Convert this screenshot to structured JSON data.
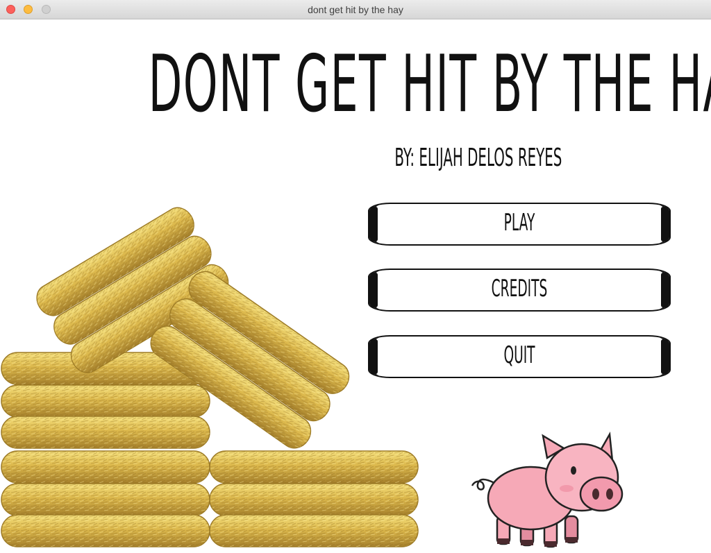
{
  "window": {
    "title": "dont get hit by the hay"
  },
  "game": {
    "title": "DONT GET HIT BY THE HAY",
    "author": "BY: ELIJAH DELOS REYES"
  },
  "menu": {
    "play": "PLAY",
    "credits": "CREDITS",
    "quit": "QUIT"
  },
  "colors": {
    "hay_light": "#f2d86a",
    "hay_mid": "#d8b445",
    "hay_dark": "#a9832a",
    "pig_body": "#f6a9b7",
    "pig_dark": "#e07f92",
    "text": "#111111"
  }
}
